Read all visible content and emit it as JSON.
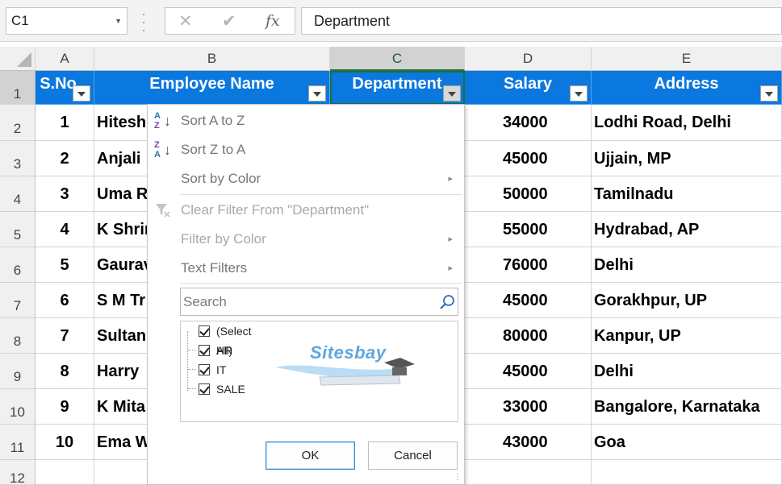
{
  "formula_bar": {
    "name_box": "C1",
    "content": "Department",
    "fx_label": "fx",
    "cancel_glyph": "✕",
    "enter_glyph": "✔"
  },
  "columns": [
    {
      "letter": "A"
    },
    {
      "letter": "B"
    },
    {
      "letter": "C"
    },
    {
      "letter": "D"
    },
    {
      "letter": "E"
    }
  ],
  "rows": [
    "1",
    "2",
    "3",
    "4",
    "5",
    "6",
    "7",
    "8",
    "9",
    "10",
    "11",
    "12"
  ],
  "headers": {
    "sno": "S.No",
    "name": "Employee Name",
    "dept": "Department",
    "salary": "Salary",
    "address": "Address"
  },
  "data_rows": [
    {
      "sno": "1",
      "name": "Hitesh",
      "salary": "34000",
      "address": "Lodhi Road, Delhi"
    },
    {
      "sno": "2",
      "name": "Anjali",
      "salary": "45000",
      "address": "Ujjain, MP"
    },
    {
      "sno": "3",
      "name": "Uma R",
      "salary": "50000",
      "address": "Tamilnadu"
    },
    {
      "sno": "4",
      "name": "K Shrin",
      "salary": "55000",
      "address": "Hydrabad, AP"
    },
    {
      "sno": "5",
      "name": "Gaurav",
      "salary": "76000",
      "address": "Delhi"
    },
    {
      "sno": "6",
      "name": "S M Tr",
      "salary": "45000",
      "address": "Gorakhpur, UP"
    },
    {
      "sno": "7",
      "name": "Sultan",
      "salary": "80000",
      "address": "Kanpur, UP"
    },
    {
      "sno": "8",
      "name": "Harry",
      "salary": "45000",
      "address": "Delhi"
    },
    {
      "sno": "9",
      "name": "K Mita",
      "salary": "33000",
      "address": "Bangalore, Karnataka"
    },
    {
      "sno": "10",
      "name": "Ema W",
      "salary": "43000",
      "address": "Goa"
    }
  ],
  "filter_menu": {
    "sort_az": "Sort A to Z",
    "sort_za": "Sort Z to A",
    "sort_by_color": "Sort by Color",
    "clear_filter": "Clear Filter From \"Department\"",
    "filter_by_color": "Filter by Color",
    "text_filters": "Text Filters",
    "search_placeholder": "Search",
    "sort_icon_az_top": "A",
    "sort_icon_az_bottom": "Z",
    "sort_icon_za_top": "Z",
    "sort_icon_za_bottom": "A",
    "submenu_arrow": "▸",
    "items": [
      {
        "label": "(Select All)",
        "checked": true
      },
      {
        "label": "HR",
        "checked": true
      },
      {
        "label": "IT",
        "checked": true
      },
      {
        "label": "SALE",
        "checked": true
      }
    ],
    "ok_label": "OK",
    "cancel_label": "Cancel",
    "resize_grip": "⋮"
  },
  "watermark": {
    "text": "Sitesbay"
  },
  "colors": {
    "header_fill": "#0a78de",
    "selection_green": "#217346"
  }
}
